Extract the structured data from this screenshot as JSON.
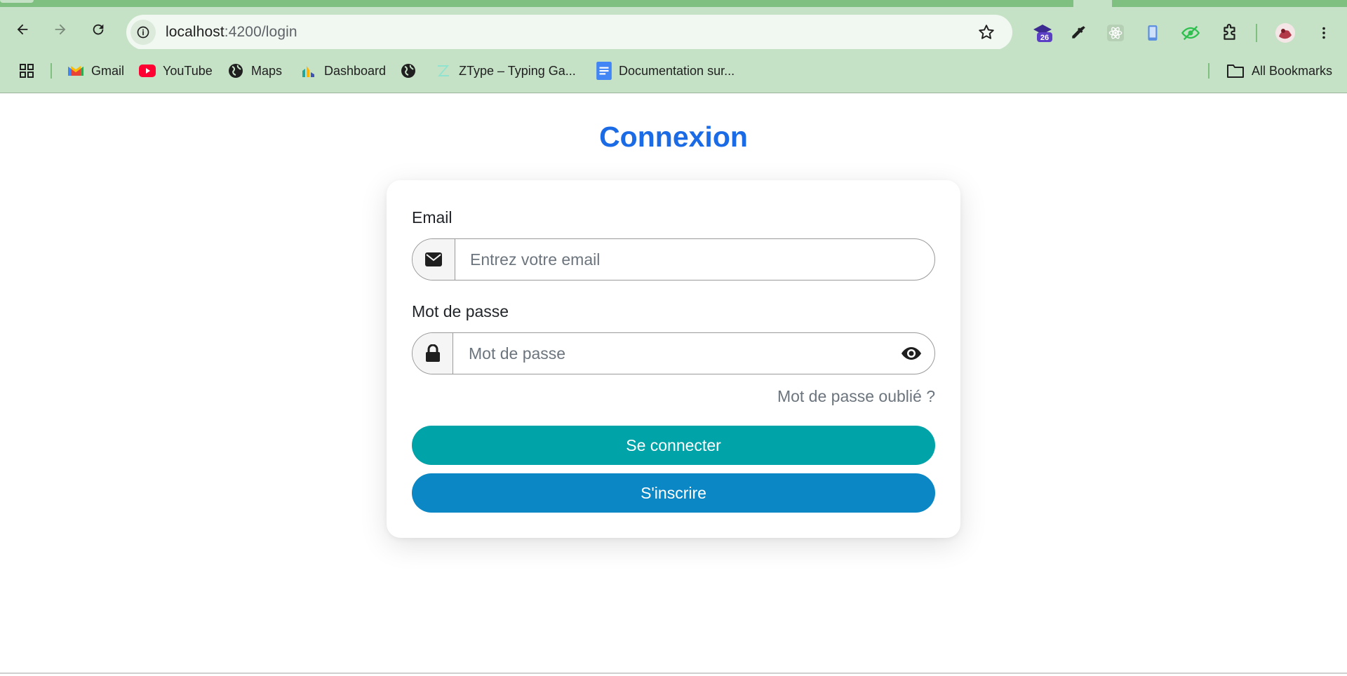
{
  "browser": {
    "url_host": "localhost",
    "url_path": ":4200/login",
    "extension_badge": "26",
    "bookmarks": [
      {
        "label": "Gmail",
        "icon": "gmail-icon"
      },
      {
        "label": "YouTube",
        "icon": "youtube-icon"
      },
      {
        "label": "Maps",
        "icon": "globe-icon"
      },
      {
        "label": "Dashboard",
        "icon": "dashboard-icon"
      },
      {
        "label": "",
        "icon": "globe-icon"
      },
      {
        "label": "ZType – Typing Ga...",
        "icon": "ztype-icon"
      },
      {
        "label": "Documentation sur...",
        "icon": "docs-icon"
      }
    ],
    "all_bookmarks_label": "All Bookmarks"
  },
  "login": {
    "title": "Connexion",
    "email_label": "Email",
    "email_placeholder": "Entrez votre email",
    "email_value": "",
    "password_label": "Mot de passe",
    "password_placeholder": "Mot de passe",
    "password_value": "",
    "forgot_label": "Mot de passe oublié ?",
    "login_button": "Se connecter",
    "register_button": "S'inscrire"
  },
  "colors": {
    "title": "#1a6be5",
    "login_button": "#00a3a7",
    "register_button": "#0a87c4",
    "chrome_green": "#c6e2c6"
  }
}
